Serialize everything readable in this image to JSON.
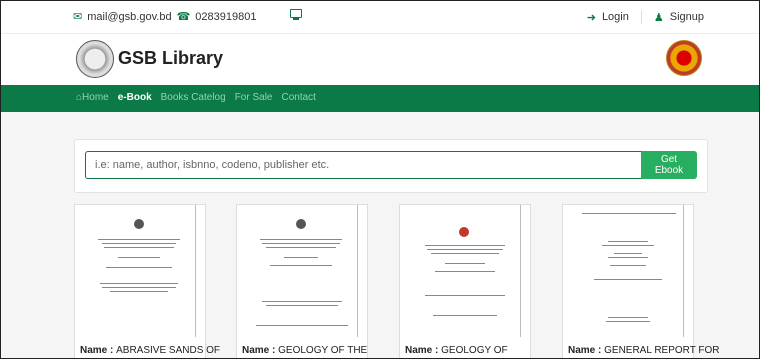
{
  "topbar": {
    "email": "mail@gsb.gov.bd",
    "phone": "0283919801",
    "login": "Login",
    "signup": "Signup"
  },
  "brand": {
    "title": "GSB Library"
  },
  "nav": {
    "items": [
      {
        "label": "Home"
      },
      {
        "label": "e-Book"
      },
      {
        "label": "Books Catelog"
      },
      {
        "label": "For Sale"
      },
      {
        "label": "Contact"
      }
    ]
  },
  "search": {
    "placeholder": "i.e: name, author, isbnno, codeno, publisher etc.",
    "button": "Get Ebook"
  },
  "books": [
    {
      "prefix": "Name : ",
      "title": "ABRASIVE SANDS OF"
    },
    {
      "prefix": "Name : ",
      "title": "GEOLOGY OF THE"
    },
    {
      "prefix": "Name : ",
      "title": "GEOLOGY OF"
    },
    {
      "prefix": "Name : ",
      "title": "GENERAL REPORT FOR"
    }
  ],
  "colors": {
    "brand_green": "#0b7a47",
    "button_green": "#27ae60"
  }
}
